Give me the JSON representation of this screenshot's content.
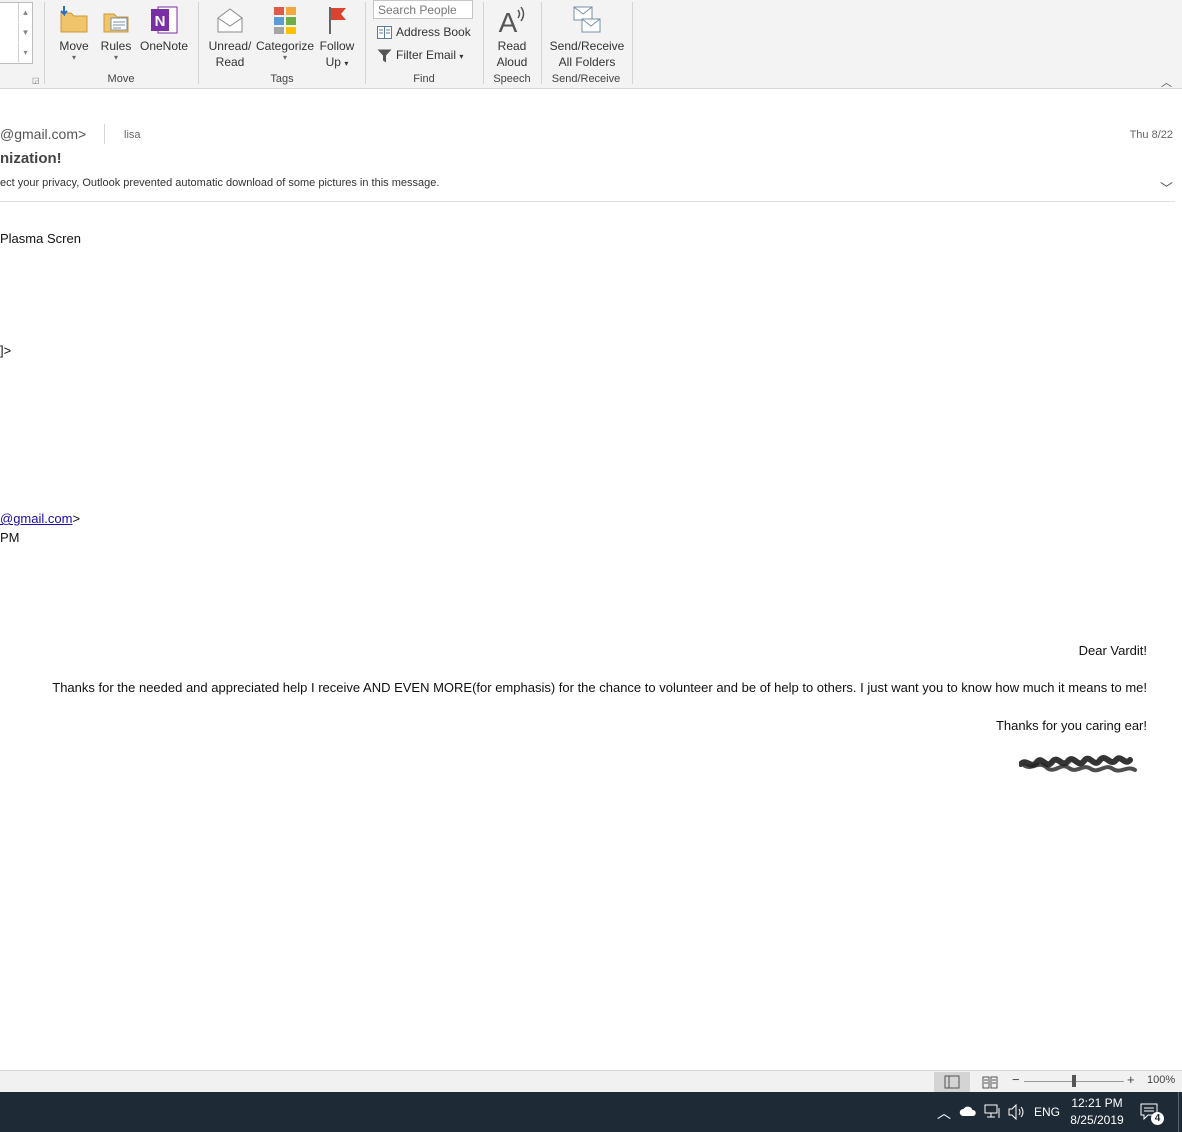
{
  "ribbon": {
    "buttons": {
      "move": "Move",
      "rules": "Rules",
      "onenote": "OneNote",
      "unread_line1": "Unread/",
      "unread_line2": "Read",
      "categorize": "Categorize",
      "follow_line1": "Follow",
      "follow_line2": "Up",
      "read_aloud_line1": "Read",
      "read_aloud_line2": "Aloud",
      "sendrecv_line1": "Send/Receive",
      "sendrecv_line2": "All Folders"
    },
    "search_placeholder": "Search People",
    "address_book": "Address Book",
    "filter_email": "Filter Email",
    "groups": {
      "move": "Move",
      "tags": "Tags",
      "find": "Find",
      "speech": "Speech",
      "send_receive": "Send/Receive"
    },
    "colors": {
      "onenote": "#7b2fa5",
      "flag": "#d9432f",
      "folder": "#f0c46b"
    }
  },
  "message": {
    "from_partial": "@gmail.com>",
    "to": "lisa",
    "date": "Thu 8/22",
    "subject_partial": "nization!",
    "privacy_notice_partial": "ect your privacy, Outlook prevented automatic download of some pictures in this message."
  },
  "body": {
    "line_plasma": "Plasma Scren",
    "line_gt": "]>",
    "email_link": "@gmail.com",
    "email_suffix": ">",
    "line_pm": "PM",
    "greeting": "Dear Vardit!",
    "main_text": "Thanks for the needed and appreciated help I receive AND EVEN MORE(for emphasis) for the chance to volunteer and be of help to others. I just want you to know how much it means to me!",
    "closing": "Thanks for you caring ear!"
  },
  "statusbar": {
    "zoom_level": "100%"
  },
  "taskbar": {
    "language": "ENG",
    "time": "12:21 PM",
    "date": "8/25/2019",
    "notification_count": "4"
  }
}
